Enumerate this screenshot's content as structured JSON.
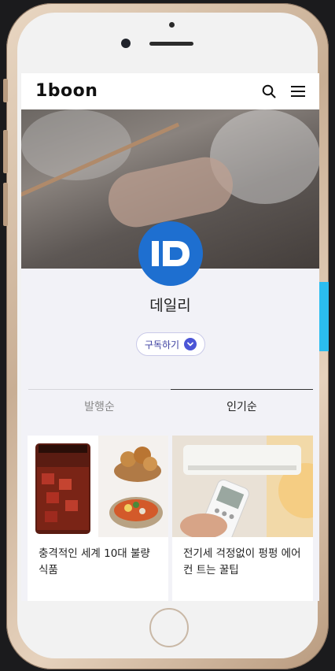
{
  "header": {
    "logo": "1boon"
  },
  "channel": {
    "name": "데일리",
    "subscribe_label": "구독하기"
  },
  "tabs": [
    {
      "label": "발행순",
      "active": false
    },
    {
      "label": "인기순",
      "active": true
    }
  ],
  "articles": [
    {
      "title": "충격적인 세계 10대 불량 식품"
    },
    {
      "title": "전기세 걱정없이 펑펑 에어컨 트는 꿀팁"
    }
  ],
  "colors": {
    "brand_blue": "#1e6fd0",
    "subscribe_accent": "#4b55d6"
  },
  "icons": [
    "search-icon",
    "menu-icon",
    "chevron-down-icon"
  ]
}
